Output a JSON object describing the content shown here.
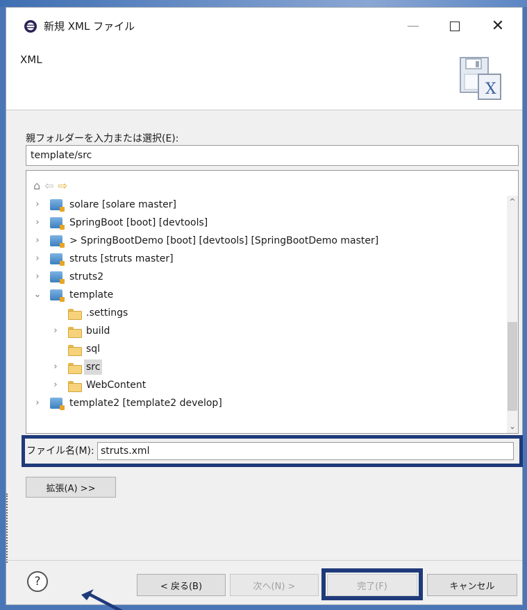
{
  "window": {
    "title": "新規 XML ファイル",
    "minimize_glyph": "—",
    "close_glyph": "✕"
  },
  "banner": {
    "title": "XML"
  },
  "parent_folder": {
    "label": "親フォルダーを入力または選択(E):",
    "value": "template/src"
  },
  "tree": {
    "items": [
      {
        "label": "solare  [solare master]",
        "type": "project",
        "twisty": "›"
      },
      {
        "label": "SpringBoot [boot] [devtools]",
        "type": "project",
        "twisty": "›"
      },
      {
        "label": "> SpringBootDemo [boot] [devtools]  [SpringBootDemo master]",
        "type": "project",
        "twisty": "›"
      },
      {
        "label": "struts  [struts master]",
        "type": "project",
        "twisty": "›"
      },
      {
        "label": "struts2",
        "type": "project",
        "twisty": "›"
      },
      {
        "label": "template",
        "type": "project",
        "twisty": "⌄"
      },
      {
        "label": ".settings",
        "type": "folder",
        "twisty": ""
      },
      {
        "label": "build",
        "type": "folder",
        "twisty": "›"
      },
      {
        "label": "sql",
        "type": "folder",
        "twisty": ""
      },
      {
        "label": "src",
        "type": "folder",
        "twisty": "›",
        "selected": true
      },
      {
        "label": "WebContent",
        "type": "folder",
        "twisty": "›"
      },
      {
        "label": "template2  [template2 develop]",
        "type": "project",
        "twisty": "›"
      }
    ],
    "scroll_up": "^",
    "scroll_down": "⌄"
  },
  "filename": {
    "label": "ファイル名(M):",
    "value": "struts.xml"
  },
  "advanced_button": "拡張(A) >>",
  "buttons": {
    "help": "?",
    "back": "< 戻る(B)",
    "next": "次へ(N) >",
    "finish": "完了(F)",
    "cancel": "キャンセル"
  },
  "colors": {
    "annotation_frame": "#1f3a7a",
    "selection": "#dadada"
  }
}
